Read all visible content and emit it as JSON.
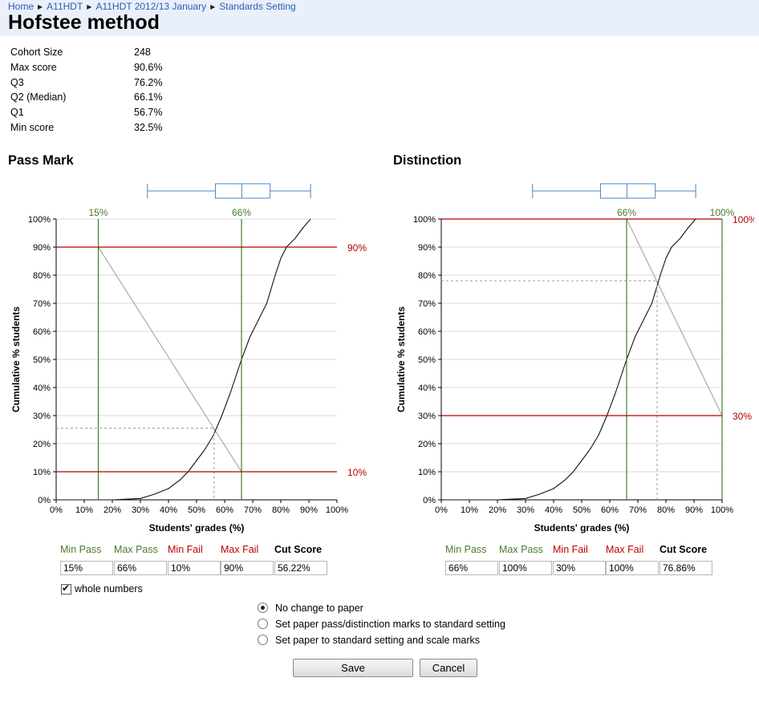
{
  "breadcrumb": [
    "Home",
    "A11HDT",
    "A11HDT 2012/13 January",
    "Standards Setting"
  ],
  "page_title": "Hofstee method",
  "stats": [
    {
      "label": "Cohort Size",
      "value": "248"
    },
    {
      "label": "Max score",
      "value": "90.6%"
    },
    {
      "label": "Q3",
      "value": "76.2%"
    },
    {
      "label": "Q2 (Median)",
      "value": "66.1%"
    },
    {
      "label": "Q1",
      "value": "56.7%"
    },
    {
      "label": "Min score",
      "value": "32.5%"
    }
  ],
  "sections": {
    "pass": "Pass Mark",
    "distinction": "Distinction"
  },
  "chart_data": [
    {
      "type": "line",
      "title": "Pass Mark",
      "xlabel": "Students' grades (%)",
      "ylabel": "Cumulative % students",
      "xlim": [
        0,
        100
      ],
      "ylim": [
        0,
        100
      ],
      "x_ticks": [
        "0%",
        "10%",
        "20%",
        "30%",
        "40%",
        "50%",
        "60%",
        "70%",
        "80%",
        "90%",
        "100%"
      ],
      "y_ticks": [
        "0%",
        "10%",
        "20%",
        "30%",
        "40%",
        "50%",
        "60%",
        "70%",
        "80%",
        "90%",
        "100%"
      ],
      "grid": true,
      "boxplot": {
        "min": 32.5,
        "q1": 56.7,
        "median": 66.1,
        "q3": 76.2,
        "max": 90.6
      },
      "vlines": [
        {
          "x": 15,
          "label": "15%"
        },
        {
          "x": 66,
          "label": "66%"
        }
      ],
      "hlines": [
        {
          "y": 90,
          "label": "90%"
        },
        {
          "y": 10,
          "label": "10%"
        }
      ],
      "diagonal": [
        [
          15,
          90
        ],
        [
          66,
          10
        ]
      ],
      "cut": {
        "x": 56.22,
        "y": 25.5
      },
      "cumulative": {
        "x": [
          0,
          20,
          30,
          35,
          40,
          44,
          47,
          50,
          53,
          56,
          59,
          62,
          64,
          66,
          69,
          72,
          75,
          78,
          80,
          82,
          85,
          88,
          90.6
        ],
        "y": [
          0,
          0,
          0.5,
          2,
          4,
          7,
          10,
          14,
          18,
          23,
          30,
          38,
          44,
          50,
          58,
          64,
          70,
          80,
          86,
          90,
          93,
          97,
          100
        ]
      }
    },
    {
      "type": "line",
      "title": "Distinction",
      "xlabel": "Students' grades (%)",
      "ylabel": "Cumulative % students",
      "xlim": [
        0,
        100
      ],
      "ylim": [
        0,
        100
      ],
      "x_ticks": [
        "0%",
        "10%",
        "20%",
        "30%",
        "40%",
        "50%",
        "60%",
        "70%",
        "80%",
        "90%",
        "100%"
      ],
      "y_ticks": [
        "0%",
        "10%",
        "20%",
        "30%",
        "40%",
        "50%",
        "60%",
        "70%",
        "80%",
        "90%",
        "100%"
      ],
      "grid": true,
      "boxplot": {
        "min": 32.5,
        "q1": 56.7,
        "median": 66.1,
        "q3": 76.2,
        "max": 90.6
      },
      "vlines": [
        {
          "x": 66,
          "label": "66%"
        },
        {
          "x": 100,
          "label": "100%"
        }
      ],
      "hlines": [
        {
          "y": 100,
          "label": "100%"
        },
        {
          "y": 30,
          "label": "30%"
        }
      ],
      "diagonal": [
        [
          66,
          100
        ],
        [
          100,
          30
        ]
      ],
      "cut": {
        "x": 76.86,
        "y": 78
      },
      "cumulative": {
        "x": [
          0,
          20,
          30,
          35,
          40,
          44,
          47,
          50,
          53,
          56,
          59,
          62,
          64,
          66,
          69,
          72,
          75,
          78,
          80,
          82,
          85,
          88,
          90.6
        ],
        "y": [
          0,
          0,
          0.5,
          2,
          4,
          7,
          10,
          14,
          18,
          23,
          30,
          38,
          44,
          50,
          58,
          64,
          70,
          80,
          86,
          90,
          93,
          97,
          100
        ]
      }
    }
  ],
  "pass_form": {
    "labels": {
      "min_pass": "Min Pass",
      "max_pass": "Max Pass",
      "min_fail": "Min Fail",
      "max_fail": "Max Fail",
      "cut": "Cut Score"
    },
    "values": {
      "min_pass": "15%",
      "max_pass": "66%",
      "min_fail": "10%",
      "max_fail": "90%",
      "cut": "56.22%"
    }
  },
  "distinction_form": {
    "labels": {
      "min_pass": "Min Pass",
      "max_pass": "Max Pass",
      "min_fail": "Min Fail",
      "max_fail": "Max Fail",
      "cut": "Cut Score"
    },
    "values": {
      "min_pass": "66%",
      "max_pass": "100%",
      "min_fail": "30%",
      "max_fail": "100%",
      "cut": "76.86%"
    }
  },
  "whole_numbers_label": "whole numbers",
  "radio_options": [
    "No change to paper",
    "Set paper pass/distinction marks to standard setting",
    "Set paper to standard setting and scale marks"
  ],
  "buttons": {
    "save": "Save",
    "cancel": "Cancel"
  },
  "colors": {
    "green": "#4a7a30",
    "red": "#b00000",
    "box": "#4a86c8",
    "grid": "#d9d9d9",
    "diag": "#b0b0b0"
  }
}
